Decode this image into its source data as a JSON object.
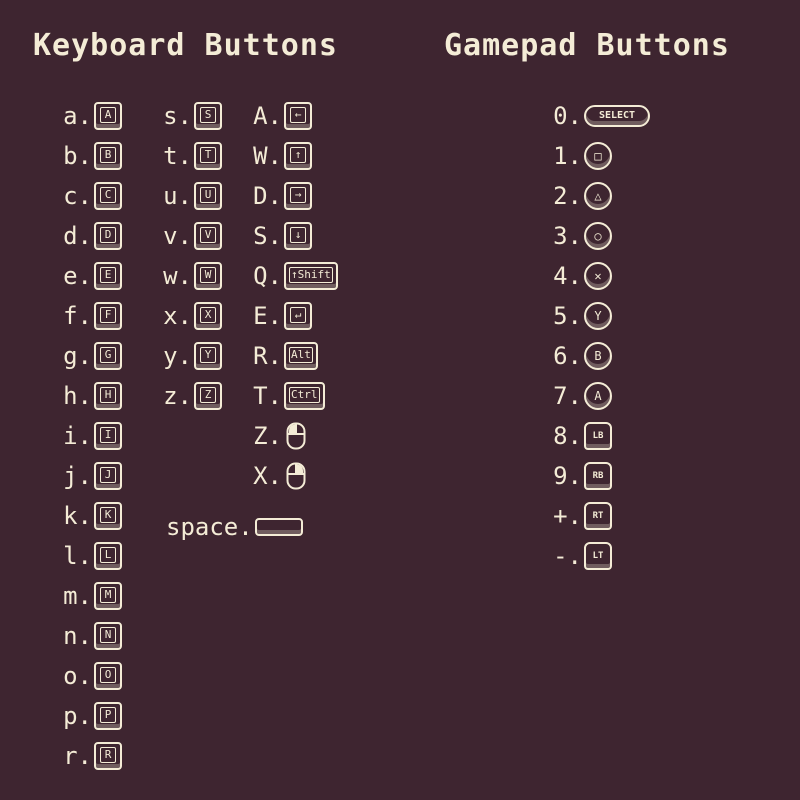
{
  "keyboard": {
    "title": "Keyboard Buttons",
    "col1": [
      {
        "label": "a.",
        "glyph": "A"
      },
      {
        "label": "b.",
        "glyph": "B"
      },
      {
        "label": "c.",
        "glyph": "C"
      },
      {
        "label": "d.",
        "glyph": "D"
      },
      {
        "label": "e.",
        "glyph": "E"
      },
      {
        "label": "f.",
        "glyph": "F"
      },
      {
        "label": "g.",
        "glyph": "G"
      },
      {
        "label": "h.",
        "glyph": "H"
      },
      {
        "label": "i.",
        "glyph": "I"
      },
      {
        "label": "j.",
        "glyph": "J"
      },
      {
        "label": "k.",
        "glyph": "K"
      },
      {
        "label": "l.",
        "glyph": "L"
      },
      {
        "label": "m.",
        "glyph": "M"
      },
      {
        "label": "n.",
        "glyph": "N"
      },
      {
        "label": "o.",
        "glyph": "O"
      },
      {
        "label": "p.",
        "glyph": "P"
      },
      {
        "label": "r.",
        "glyph": "R"
      }
    ],
    "col2": [
      {
        "label": "s.",
        "glyph": "S"
      },
      {
        "label": "t.",
        "glyph": "T"
      },
      {
        "label": "u.",
        "glyph": "U"
      },
      {
        "label": "v.",
        "glyph": "V"
      },
      {
        "label": "w.",
        "glyph": "W"
      },
      {
        "label": "x.",
        "glyph": "X"
      },
      {
        "label": "y.",
        "glyph": "Y"
      },
      {
        "label": "z.",
        "glyph": "Z"
      }
    ],
    "col3": [
      {
        "label": "A.",
        "glyph": "←",
        "kind": "key",
        "icon": "arrow-left-key-icon"
      },
      {
        "label": "W.",
        "glyph": "↑",
        "kind": "key",
        "icon": "arrow-up-key-icon"
      },
      {
        "label": "D.",
        "glyph": "→",
        "kind": "key",
        "icon": "arrow-right-key-icon"
      },
      {
        "label": "S.",
        "glyph": "↓",
        "kind": "key",
        "icon": "arrow-down-key-icon"
      },
      {
        "label": "Q.",
        "glyph": "↑Shift",
        "kind": "wide",
        "icon": "shift-key-icon"
      },
      {
        "label": "E.",
        "glyph": "↵",
        "kind": "key",
        "icon": "enter-key-icon"
      },
      {
        "label": "R.",
        "glyph": "Alt",
        "kind": "key",
        "icon": "alt-key-icon"
      },
      {
        "label": "T.",
        "glyph": "Ctrl",
        "kind": "key",
        "icon": "ctrl-key-icon"
      },
      {
        "label": "Z.",
        "glyph": "",
        "kind": "mouse-left",
        "icon": "mouse-left-click-icon"
      },
      {
        "label": "X.",
        "glyph": "",
        "kind": "mouse-right",
        "icon": "mouse-right-click-icon"
      }
    ],
    "space": {
      "label": "space.",
      "icon": "spacebar-key-icon"
    }
  },
  "gamepad": {
    "title": "Gamepad Buttons",
    "items": [
      {
        "label": "0.",
        "glyph": "SELECT",
        "kind": "select",
        "icon": "select-button-icon"
      },
      {
        "label": "1.",
        "glyph": "□",
        "kind": "round",
        "icon": "square-button-icon"
      },
      {
        "label": "2.",
        "glyph": "△",
        "kind": "round",
        "icon": "triangle-button-icon"
      },
      {
        "label": "3.",
        "glyph": "○",
        "kind": "round",
        "icon": "circle-button-icon"
      },
      {
        "label": "4.",
        "glyph": "✕",
        "kind": "round",
        "icon": "cross-button-icon"
      },
      {
        "label": "5.",
        "glyph": "Y",
        "kind": "round",
        "icon": "y-button-icon"
      },
      {
        "label": "6.",
        "glyph": "B",
        "kind": "round",
        "icon": "b-button-icon"
      },
      {
        "label": "7.",
        "glyph": "A",
        "kind": "round",
        "icon": "a-button-icon"
      },
      {
        "label": "8.",
        "glyph": "LB",
        "kind": "shoulder",
        "icon": "lb-button-icon"
      },
      {
        "label": "9.",
        "glyph": "RB",
        "kind": "shoulder",
        "icon": "rb-button-icon"
      },
      {
        "label": "+.",
        "glyph": "RT",
        "kind": "shoulder",
        "icon": "rt-button-icon"
      },
      {
        "label": "-.",
        "glyph": "LT",
        "kind": "shoulder",
        "icon": "lt-button-icon"
      }
    ]
  }
}
